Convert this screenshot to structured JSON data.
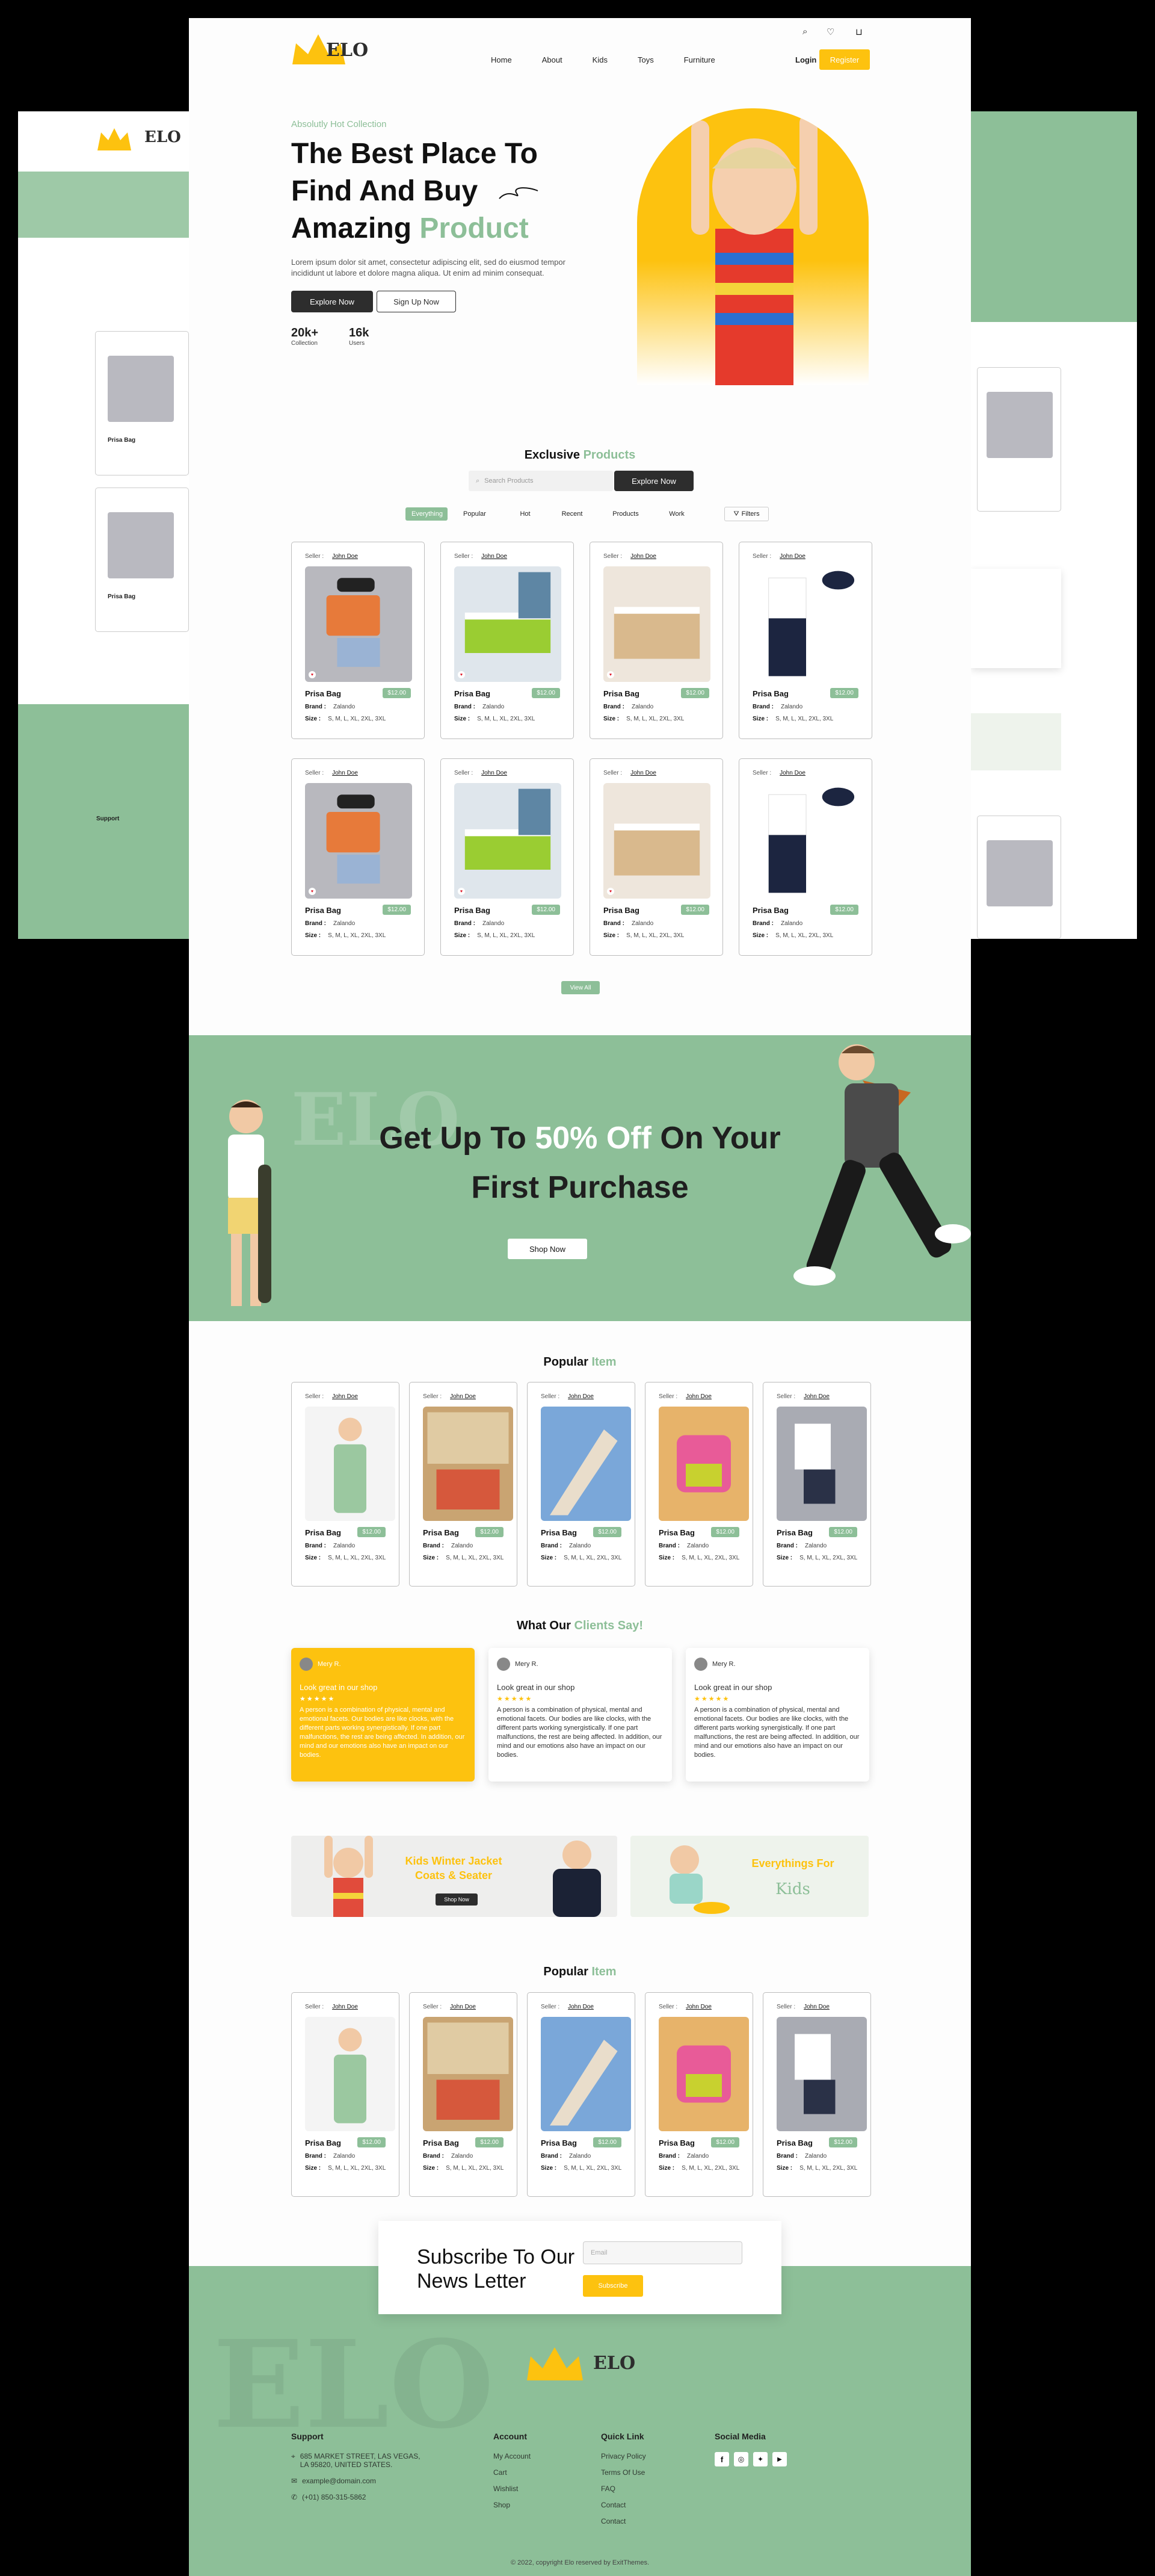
{
  "brand": {
    "logo": "ELO"
  },
  "nav": {
    "items": [
      "Home",
      "About",
      "Kids",
      "Toys",
      "Furniture"
    ],
    "login": "Login",
    "register": "Register"
  },
  "hero": {
    "eyebrow": "Absolutly Hot Collection",
    "title_line1": "The Best Place To",
    "title_line2": "Find And Buy",
    "title_line3a": "Amazing",
    "title_line3b": "Product",
    "body": "Lorem ipsum dolor sit amet, consectetur adipiscing elit, sed do eiusmod tempor incididunt ut labore et dolore magna aliqua. Ut enim ad minim consequat.",
    "btn_primary": "Explore Now",
    "btn_secondary": "Sign Up Now",
    "stat1_value": "20k+",
    "stat1_label": "Collection",
    "stat2_value": "16k",
    "stat2_label": "Users"
  },
  "exclusive": {
    "title_a": "Exclusive",
    "title_b": "Products",
    "search_placeholder": "Search Products",
    "search_button": "Explore Now",
    "tabs": [
      "Everything",
      "Popular",
      "Hot",
      "Recent",
      "Products",
      "Work"
    ],
    "filters": "Filters",
    "view_all": "View All"
  },
  "product": {
    "seller_label": "Seller :",
    "seller_name": "John Doe",
    "name": "Prisa Bag",
    "price": "$12.00",
    "brand_label": "Brand :",
    "brand_value": "Zalando",
    "size_label": "Size :",
    "size_value": "S, M, L, XL, 2XL, 3XL"
  },
  "promo": {
    "line1a": "Get Up To",
    "line1b": "50% Off",
    "line1c": "On Your",
    "line2": "First Purchase",
    "button": "Shop Now"
  },
  "popular": {
    "title_a": "Popular",
    "title_b": "Item"
  },
  "testimonials": {
    "title_a": "What Our",
    "title_b": "Clients Say!",
    "items": [
      {
        "name": "Mery R.",
        "title": "Look great in our shop",
        "stars": "★★★★★",
        "text": "A person is a combination of physical, mental and emotional facets. Our bodies are like clocks, with the different parts working synergistically. If one part malfunctions, the rest are being affected. In addition, our mind and our emotions also have an impact on our bodies."
      },
      {
        "name": "Mery R.",
        "title": "Look great in our shop",
        "stars": "★★★★★",
        "text": "A person is a combination of physical, mental and emotional facets. Our bodies are like clocks, with the different parts working synergistically. If one part malfunctions, the rest are being affected. In addition, our mind and our emotions also have an impact on our bodies."
      },
      {
        "name": "Mery R.",
        "title": "Look great in our shop",
        "stars": "★★★★★",
        "text": "A person is a combination of physical, mental and emotional facets. Our bodies are like clocks, with the different parts working synergistically. If one part malfunctions, the rest are being affected. In addition, our mind and our emotions also have an impact on our bodies."
      }
    ]
  },
  "banners": {
    "winter_line1": "Kids Winter Jacket",
    "winter_line2": "Coats & Seater",
    "winter_button": "Shop Now",
    "everything_line1": "Everythings For",
    "everything_line2": "Kids"
  },
  "newsletter": {
    "line1": "Subscribe To Our",
    "line2": "News Letter",
    "email_placeholder": "Email",
    "button": "Subscribe"
  },
  "footer": {
    "support_title": "Support",
    "address": "685 MARKET STREET, LAS VEGAS, LA 95820, UNITED STATES.",
    "email": "example@domain.com",
    "phone": "(+01) 850-315-5862",
    "account_title": "Account",
    "account_items": [
      "My Account",
      "Cart",
      "Wishlist",
      "Shop"
    ],
    "quick_title": "Quick Link",
    "quick_items": [
      "Privacy Policy",
      "Terms Of Use",
      "FAQ",
      "Contact",
      "Contact"
    ],
    "social_title": "Social Media",
    "copyright": "© 2022, copyright Elo reserved by ExitThemes."
  },
  "colors": {
    "green": "#8dbf98",
    "yellow": "#fdc20f",
    "dark": "#2d2d2d"
  }
}
